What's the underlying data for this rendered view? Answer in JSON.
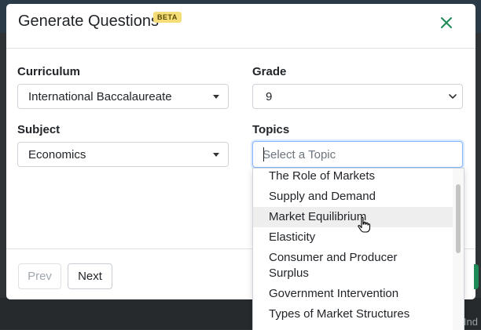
{
  "background": {
    "corner_text": "Ind"
  },
  "modal": {
    "title": "Generate Questions",
    "badge": "BETA",
    "close_glyph": "×"
  },
  "form": {
    "curriculum": {
      "label": "Curriculum",
      "value": "International Baccalaureate"
    },
    "grade": {
      "label": "Grade",
      "value": "9"
    },
    "subject": {
      "label": "Subject",
      "value": "Economics"
    },
    "topics": {
      "label": "Topics",
      "placeholder": "Select a Topic",
      "options": [
        "The Role of Markets",
        "Supply and Demand",
        "Market Equilibrium",
        "Elasticity",
        "Consumer and Producer Surplus",
        "Government Intervention",
        "Types of Market Structures"
      ],
      "hovered_option": "Market Equilibrium"
    }
  },
  "footer": {
    "prev_label": "Prev",
    "next_label": "Next"
  },
  "colors": {
    "accent": "#1e8a57",
    "badge": "#f5dd78",
    "focus": "#86b7fe"
  }
}
